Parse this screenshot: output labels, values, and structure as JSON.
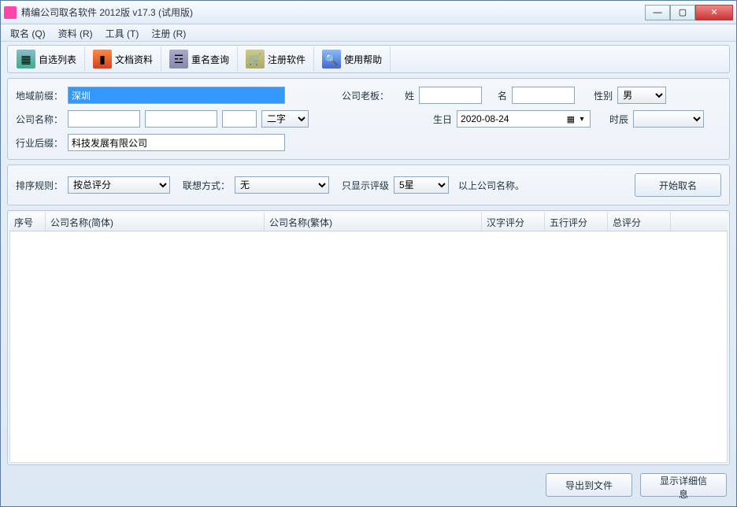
{
  "title": "精编公司取名软件 2012版 v17.3  (试用版)",
  "menu": {
    "naming": "取名 (Q)",
    "data": "资料 (R)",
    "tools": "工具 (T)",
    "register": "注册 (R)"
  },
  "toolbar": {
    "custom_list": "自选列表",
    "doc_data": "文档资料",
    "dup_check": "重名查询",
    "register": "注册软件",
    "help": "使用帮助"
  },
  "labels": {
    "region_prefix": "地域前缀：",
    "company_name": "公司名称：",
    "industry_suffix": "行业后缀：",
    "boss": "公司老板：",
    "surname": "姓",
    "given": "名",
    "gender": "性别",
    "birthday": "生日",
    "hour": "时辰",
    "sort_rule": "排序规则：",
    "assoc_method": "联想方式：",
    "show_only": "只显示评级",
    "above_names": "以上公司名称。"
  },
  "values": {
    "region_prefix": "深圳",
    "industry_suffix": "科技发展有限公司",
    "name_len": "二字",
    "gender": "男",
    "birthday": "2020-08-24",
    "sort_rule": "按总评分",
    "assoc_method": "无",
    "star": "5星"
  },
  "buttons": {
    "start": "开始取名",
    "export": "导出到文件",
    "detail": "显示详细信息"
  },
  "columns": {
    "no": "序号",
    "name_s": "公司名称(简体)",
    "name_t": "公司名称(繁体)",
    "hanzi": "汉字评分",
    "wuxing": "五行评分",
    "total": "总评分"
  }
}
